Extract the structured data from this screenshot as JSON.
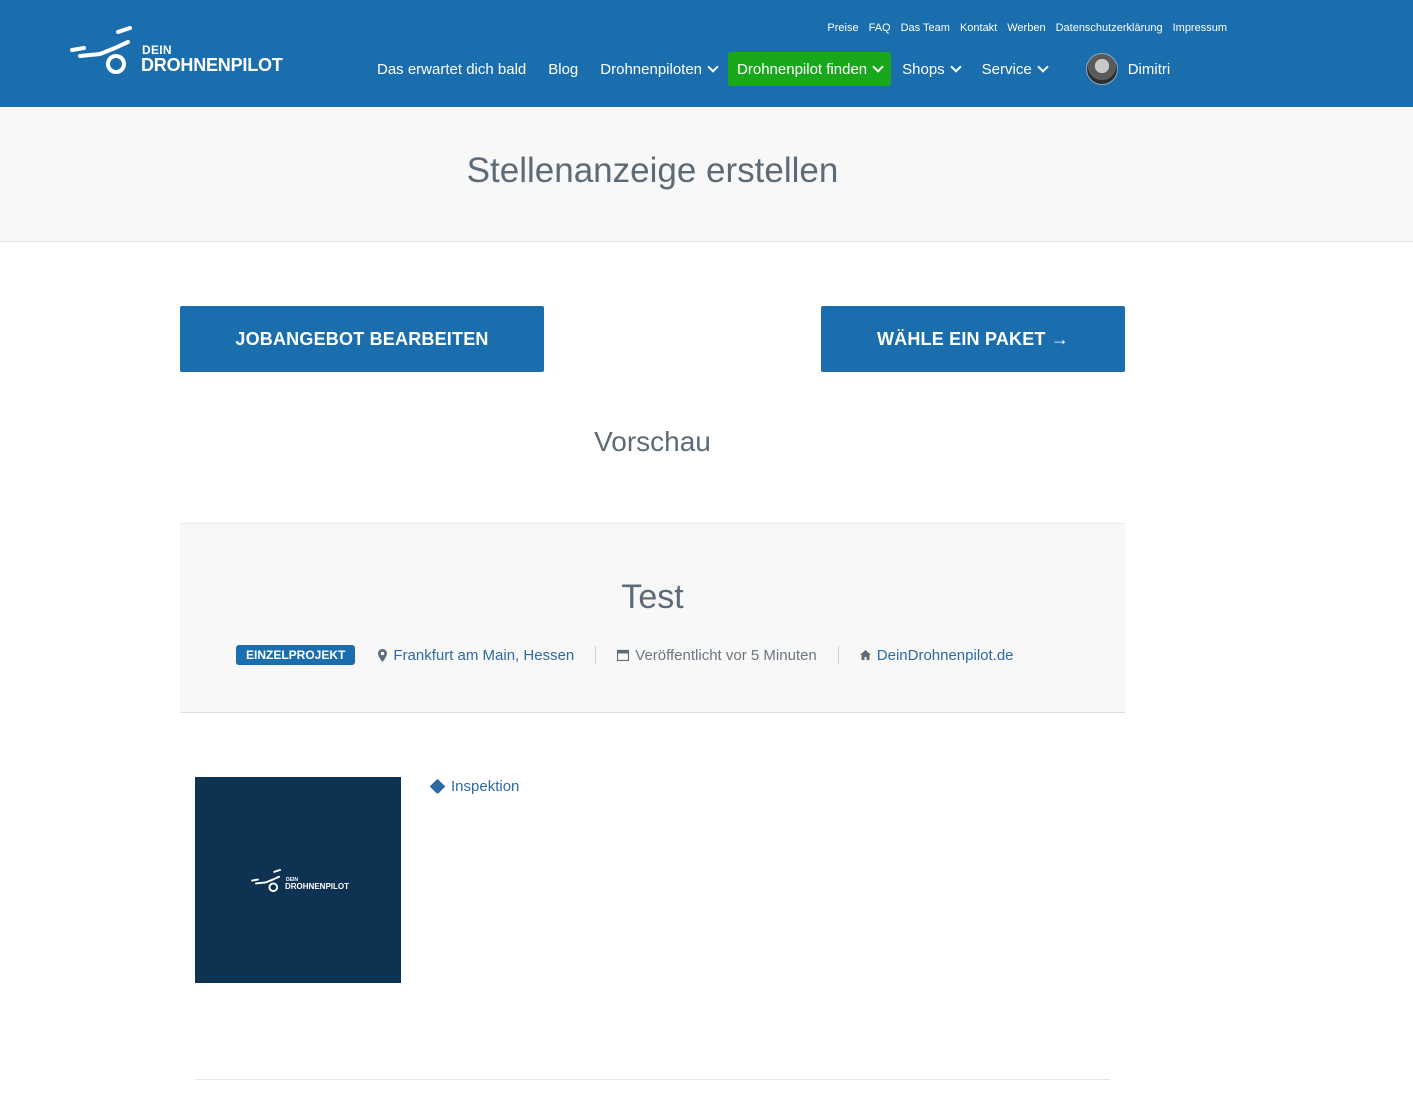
{
  "header": {
    "logo_small": "DEIN",
    "logo_big": "DROHNENPILOT",
    "top_links": [
      "Preise",
      "FAQ",
      "Das Team",
      "Kontakt",
      "Werben",
      "Datenschutzerklärung",
      "Impressum"
    ],
    "main_nav": [
      {
        "label": "Das erwartet dich bald",
        "dropdown": false
      },
      {
        "label": "Blog",
        "dropdown": false
      },
      {
        "label": "Drohnenpiloten",
        "dropdown": true
      },
      {
        "label": "Drohnenpilot finden",
        "dropdown": true,
        "active": true
      },
      {
        "label": "Shops",
        "dropdown": true
      },
      {
        "label": "Service",
        "dropdown": true
      }
    ],
    "user_name": "Dimitri"
  },
  "page": {
    "title": "Stellenanzeige erstellen",
    "edit_button": "JOBANGEBOT BEARBEITEN",
    "package_button": "WÄHLE EIN PAKET →",
    "preview_heading": "Vorschau"
  },
  "job": {
    "title": "Test",
    "type_badge": "EINZELPROJEKT",
    "location": "Frankfurt am Main, Hessen",
    "published": "Veröffentlicht vor 5 Minuten",
    "company": "DeinDrohnenpilot.de",
    "tag": "Inspektion",
    "company_logo_small": "DEIN",
    "company_logo_big": "DROHNENPILOT"
  },
  "colors": {
    "brand_blue": "#1a6ead",
    "active_green": "#19a81b",
    "logo_bg": "#0e3252"
  }
}
